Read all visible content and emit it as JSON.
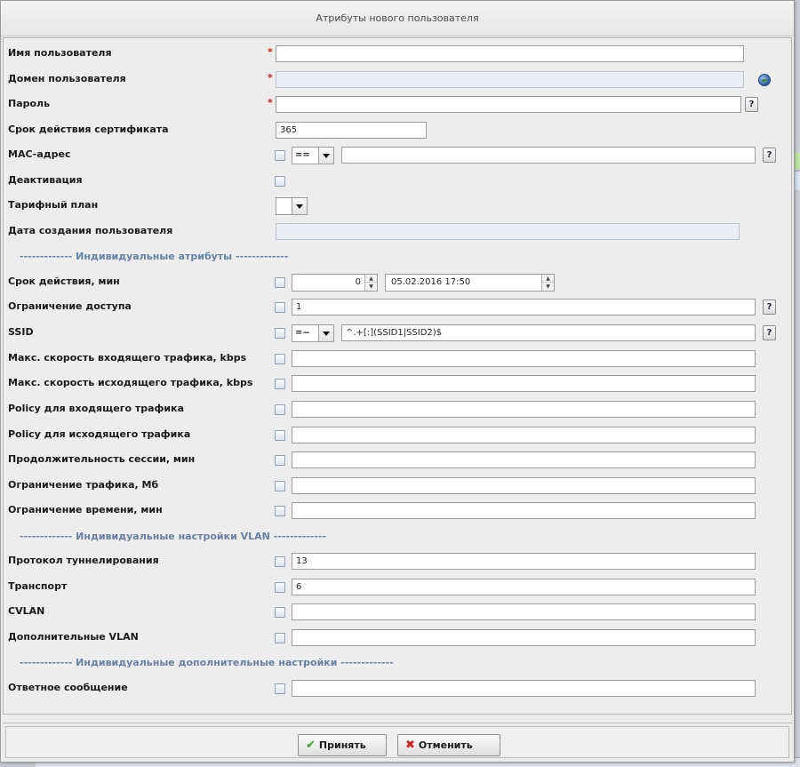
{
  "dialog": {
    "title": "Атрибуты нового пользователя"
  },
  "fields": {
    "username": {
      "label": "Имя пользователя",
      "required": "*",
      "value": ""
    },
    "domain": {
      "label": "Домен пользователя",
      "required": "*",
      "value": ""
    },
    "password": {
      "label": "Пароль",
      "required": "*",
      "value": "",
      "help": "?"
    },
    "cert_validity": {
      "label": "Срок действия сертификата",
      "value": "365"
    },
    "mac": {
      "label": "MAC-адрес",
      "operator": "==",
      "value": "",
      "help": "?"
    },
    "deactivation": {
      "label": "Деактивация"
    },
    "tariff": {
      "label": "Тарифный план",
      "value": ""
    },
    "created": {
      "label": "Дата создания пользователя",
      "value": ""
    }
  },
  "sections": {
    "individual_attrs": "------------- Индивидуальные атрибуты -------------",
    "individual_vlan": "------------- Индивидуальные настройки VLAN -------------",
    "individual_extra": "------------- Индивидуальные дополнительные настройки -------------"
  },
  "attrs": {
    "expiry": {
      "label": "Срок действия, мин",
      "minutes": "0",
      "datetime": "05.02.2016 17:50"
    },
    "access_limit": {
      "label": "Ограничение доступа",
      "value": "1",
      "help": "?"
    },
    "ssid": {
      "label": "SSID",
      "operator": "=~",
      "value": "^.+[:](SSID1|SSID2)$",
      "help": "?"
    },
    "max_in": {
      "label": "Макс. скорость входящего трафика, kbps",
      "value": ""
    },
    "max_out": {
      "label": "Макс. скорость исходящего трафика, kbps",
      "value": ""
    },
    "policy_in": {
      "label": "Policy для входящего трафика",
      "value": ""
    },
    "policy_out": {
      "label": "Policy для исходящего трафика",
      "value": ""
    },
    "session_len": {
      "label": "Продолжительность сессии, мин",
      "value": ""
    },
    "traffic_limit": {
      "label": "Ограничение трафика, Мб",
      "value": ""
    },
    "time_limit": {
      "label": "Ограничение времени, мин",
      "value": ""
    }
  },
  "vlan": {
    "tunnel_protocol": {
      "label": "Протокол туннелирования",
      "value": "13"
    },
    "transport": {
      "label": "Транспорт",
      "value": "6"
    },
    "cvlan": {
      "label": "CVLAN",
      "value": ""
    },
    "extra_vlan": {
      "label": "Дополнительные VLAN",
      "value": ""
    }
  },
  "extra": {
    "reply_message": {
      "label": "Ответное сообщение",
      "value": ""
    }
  },
  "buttons": {
    "accept": "Принять",
    "cancel": "Отменить"
  },
  "icons": {
    "ok": "check-icon",
    "cancel": "cross-icon",
    "domain": "globe-icon"
  },
  "colors": {
    "required": "#d21b1b",
    "section": "#6781a3",
    "ok_icon": "#3aa12a",
    "cancel_icon": "#d0221f"
  }
}
